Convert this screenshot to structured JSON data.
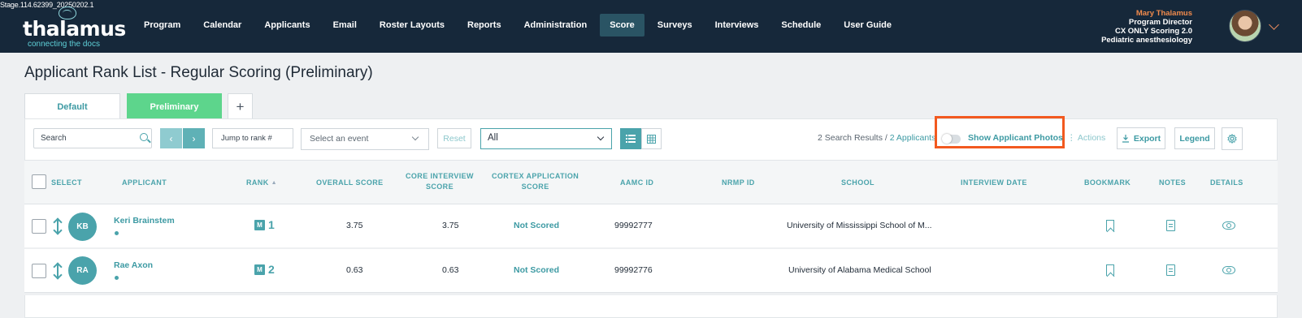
{
  "build": "Stage.114.62399_20250202.1",
  "brand": {
    "name": "thalamus",
    "tagline": "connecting the docs"
  },
  "nav": {
    "items": [
      {
        "label": "Program"
      },
      {
        "label": "Calendar"
      },
      {
        "label": "Applicants"
      },
      {
        "label": "Email"
      },
      {
        "label": "Roster Layouts"
      },
      {
        "label": "Reports"
      },
      {
        "label": "Administration"
      },
      {
        "label": "Score",
        "active": true
      },
      {
        "label": "Surveys"
      },
      {
        "label": "Interviews"
      },
      {
        "label": "Schedule"
      },
      {
        "label": "User Guide"
      }
    ]
  },
  "user": {
    "name": "Mary Thalamus",
    "role": "Program Director",
    "program": "CX ONLY Scoring 2.0",
    "specialty": "Pediatric anesthesiology"
  },
  "page": {
    "title": "Applicant Rank List - Regular Scoring (Preliminary)"
  },
  "view_tabs": [
    {
      "label": "Default"
    },
    {
      "label": "Preliminary",
      "active": true
    },
    {
      "label": "+"
    }
  ],
  "toolbar": {
    "search_placeholder": "Search",
    "prev_label": "‹",
    "next_label": "›",
    "jump_placeholder": "Jump to rank #",
    "event_placeholder": "Select an event",
    "reset_label": "Reset",
    "filter_value": "All",
    "results_prefix": "2 Search Results / ",
    "results_link": "2 Applicants",
    "photos_label": "Show Applicant Photos",
    "photos_enabled": false,
    "actions_label": "⋮ Actions",
    "export_label": "Export",
    "legend_label": "Legend"
  },
  "table": {
    "columns": {
      "select": "SELECT",
      "applicant": "APPLICANT",
      "rank": "RANK",
      "overall": "OVERALL SCORE",
      "core_1": "CORE INTERVIEW",
      "core_2": "SCORE",
      "cortex_1": "CORTEX APPLICATION",
      "cortex_2": "SCORE",
      "aamc": "AAMC ID",
      "nrmp": "NRMP ID",
      "school": "SCHOOL",
      "interview_date": "INTERVIEW DATE",
      "bookmark": "BOOKMARK",
      "notes": "NOTES",
      "details": "DETAILS"
    },
    "rows": [
      {
        "initials": "KB",
        "name": "Keri Brainstem",
        "badge": "M",
        "rank": "1",
        "overall": "3.75",
        "core": "3.75",
        "cortex": "Not Scored",
        "aamc": "99992777",
        "nrmp": "",
        "school": "University of Mississippi School of M...",
        "interview_date": ""
      },
      {
        "initials": "RA",
        "name": "Rae Axon",
        "badge": "M",
        "rank": "2",
        "overall": "0.63",
        "core": "0.63",
        "cortex": "Not Scored",
        "aamc": "99992776",
        "nrmp": "",
        "school": "University of Alabama Medical School",
        "interview_date": ""
      }
    ]
  },
  "colors": {
    "nav_bg": "#16283a",
    "accent": "#4aa3ab",
    "active_tab": "#5dd58c",
    "highlight": "#f2591f",
    "user_name": "#f08a4c"
  }
}
